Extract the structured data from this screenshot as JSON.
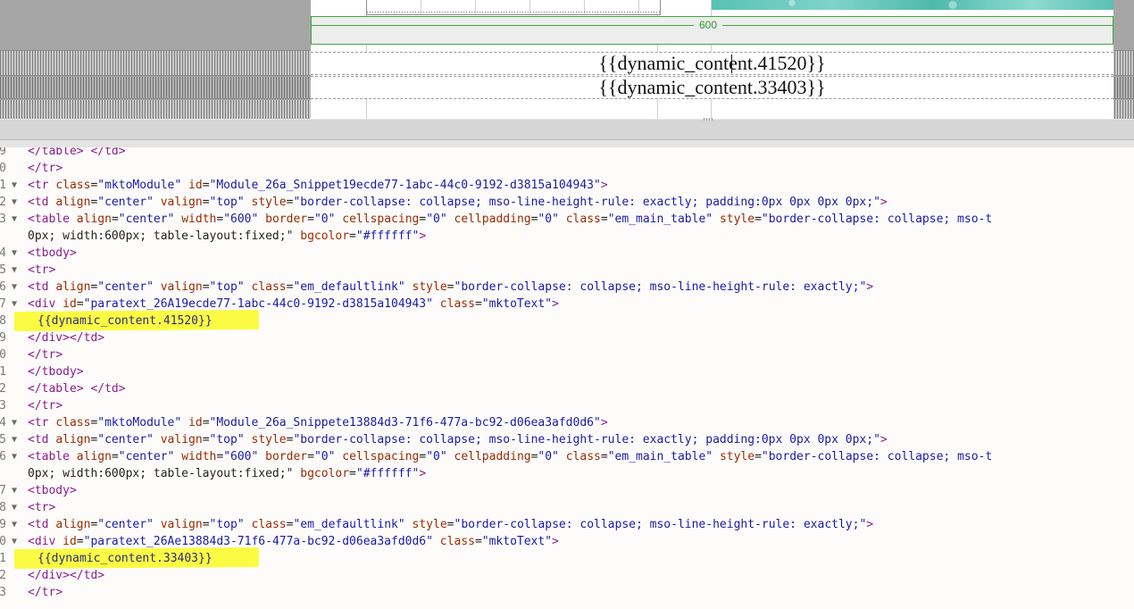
{
  "preview": {
    "width_label": "600",
    "dynamic_content_lines": [
      "{{dynamic_content.41520}}",
      "{{dynamic_content.33403}}"
    ]
  },
  "colors": {
    "guide_green": "#3fa83f",
    "highlight_yellow": "#fbfb44",
    "tag_purple": "#8b1b8b",
    "value_blue": "#1a1aa6"
  },
  "code": {
    "lines": [
      {
        "num": "9",
        "fold": false,
        "text": "</table> </td>"
      },
      {
        "num": "0",
        "fold": false,
        "text": "</tr>"
      },
      {
        "num": "1",
        "fold": true,
        "text": "<tr class=\"mktoModule\" id=\"Module_26a_Snippet19ecde77-1abc-44c0-9192-d3815a104943\">"
      },
      {
        "num": "2",
        "fold": true,
        "text": "<td align=\"center\" valign=\"top\" style=\"border-collapse: collapse; mso-line-height-rule: exactly; padding:0px 0px 0px 0px;\">"
      },
      {
        "num": "3",
        "fold": true,
        "text": "<table align=\"center\" width=\"600\" border=\"0\" cellspacing=\"0\" cellpadding=\"0\" class=\"em_main_table\" style=\"border-collapse: collapse; mso-t"
      },
      {
        "num": "",
        "fold": false,
        "text": "0px; width:600px; table-layout:fixed;\" bgcolor=\"#ffffff\">"
      },
      {
        "num": "4",
        "fold": true,
        "text": "<tbody>"
      },
      {
        "num": "5",
        "fold": true,
        "text": "<tr>"
      },
      {
        "num": "6",
        "fold": true,
        "text": "<td align=\"center\" valign=\"top\" class=\"em_defaultlink\" style=\"border-collapse: collapse; mso-line-height-rule: exactly;\">"
      },
      {
        "num": "7",
        "fold": true,
        "text": "<div id=\"paratext_26A19ecde77-1abc-44c0-9192-d3815a104943\" class=\"mktoText\">"
      },
      {
        "num": "8",
        "fold": false,
        "text": "{{dynamic_content.41520}}",
        "highlight": true
      },
      {
        "num": "9",
        "fold": false,
        "text": "</div></td>"
      },
      {
        "num": "0",
        "fold": false,
        "text": "</tr>"
      },
      {
        "num": "1",
        "fold": false,
        "text": "</tbody>"
      },
      {
        "num": "2",
        "fold": false,
        "text": "</table> </td>"
      },
      {
        "num": "3",
        "fold": false,
        "text": "</tr>"
      },
      {
        "num": "4",
        "fold": true,
        "text": "<tr class=\"mktoModule\" id=\"Module_26a_Snippete13884d3-71f6-477a-bc92-d06ea3afd0d6\">"
      },
      {
        "num": "5",
        "fold": true,
        "text": "<td align=\"center\" valign=\"top\" style=\"border-collapse: collapse; mso-line-height-rule: exactly; padding:0px 0px 0px 0px;\">"
      },
      {
        "num": "6",
        "fold": true,
        "text": "<table align=\"center\" width=\"600\" border=\"0\" cellspacing=\"0\" cellpadding=\"0\" class=\"em_main_table\" style=\"border-collapse: collapse; mso-t"
      },
      {
        "num": "",
        "fold": false,
        "text": "0px; width:600px; table-layout:fixed;\" bgcolor=\"#ffffff\">"
      },
      {
        "num": "7",
        "fold": true,
        "text": "<tbody>"
      },
      {
        "num": "8",
        "fold": true,
        "text": "<tr>"
      },
      {
        "num": "9",
        "fold": true,
        "text": "<td align=\"center\" valign=\"top\" class=\"em_defaultlink\" style=\"border-collapse: collapse; mso-line-height-rule: exactly;\">"
      },
      {
        "num": "0",
        "fold": true,
        "text": "<div id=\"paratext_26Ae13884d3-71f6-477a-bc92-d06ea3afd0d6\" class=\"mktoText\">"
      },
      {
        "num": "1",
        "fold": false,
        "text": "{{dynamic_content.33403}}",
        "highlight": true
      },
      {
        "num": "2",
        "fold": false,
        "text": "</div></td>"
      },
      {
        "num": "3",
        "fold": false,
        "text": "</tr>"
      }
    ]
  }
}
